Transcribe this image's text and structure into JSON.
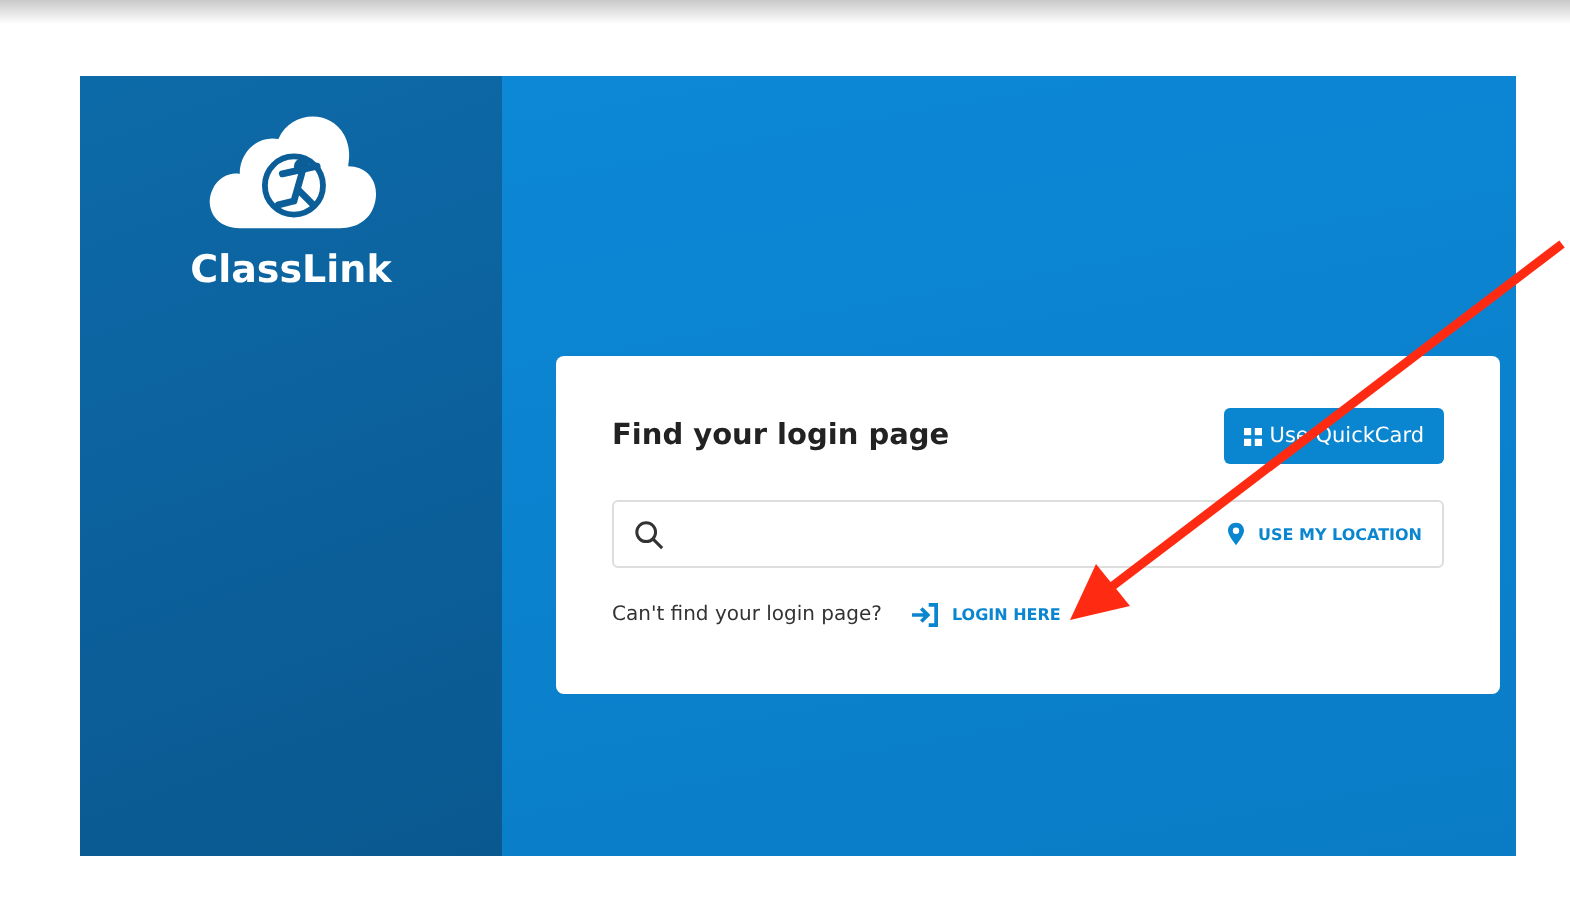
{
  "brand": {
    "name": "ClassLink"
  },
  "card": {
    "title": "Find your login page",
    "quickcard_button": "Use QuickCard",
    "location_button": "USE MY LOCATION",
    "help_text": "Can't find your login page?",
    "login_link": "LOGIN HERE"
  }
}
